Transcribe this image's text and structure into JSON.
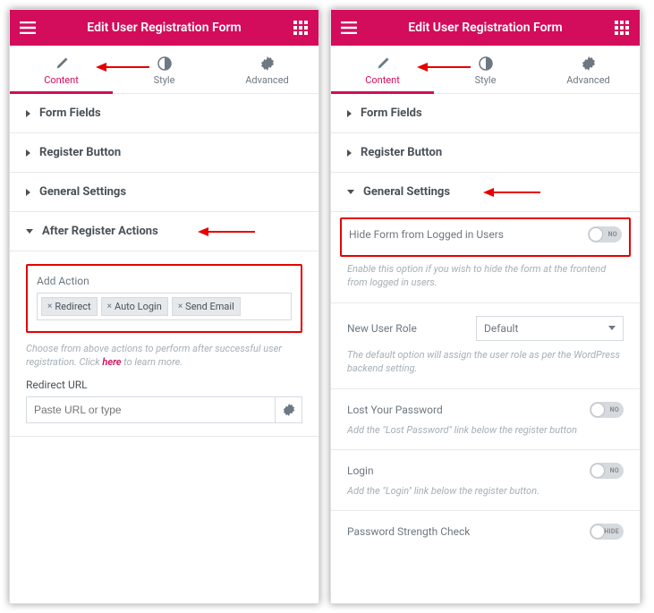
{
  "header": {
    "title": "Edit User Registration Form"
  },
  "tabs": {
    "content": "Content",
    "style": "Style",
    "advanced": "Advanced"
  },
  "sections": {
    "form_fields": "Form Fields",
    "register_button": "Register Button",
    "general_settings": "General Settings",
    "after_register": "After Register Actions"
  },
  "after_register": {
    "add_action_label": "Add Action",
    "tags": [
      "Redirect",
      "Auto Login",
      "Send Email"
    ],
    "help_pre": "Choose from above actions to perform after successful user registration. Click ",
    "help_link": "here",
    "help_post": " to learn more.",
    "redirect_label": "Redirect URL",
    "url_placeholder": "Paste URL or type"
  },
  "general": {
    "hide_form_label": "Hide Form from Logged in Users",
    "hide_form_toggle": "NO",
    "hide_form_help": "Enable this option if you wish to hide the form at the frontend from logged in users.",
    "new_user_role_label": "New User Role",
    "new_user_role_value": "Default",
    "new_user_role_help": "The default option will assign the user role as per the WordPress backend setting.",
    "lost_password_label": "Lost Your Password",
    "lost_password_toggle": "NO",
    "lost_password_help": "Add the \"Lost Password\" link below the register button",
    "login_label": "Login",
    "login_toggle": "NO",
    "login_help": "Add the \"Login\" link below the register button.",
    "password_strength_label": "Password Strength Check",
    "password_strength_toggle": "HIDE"
  }
}
